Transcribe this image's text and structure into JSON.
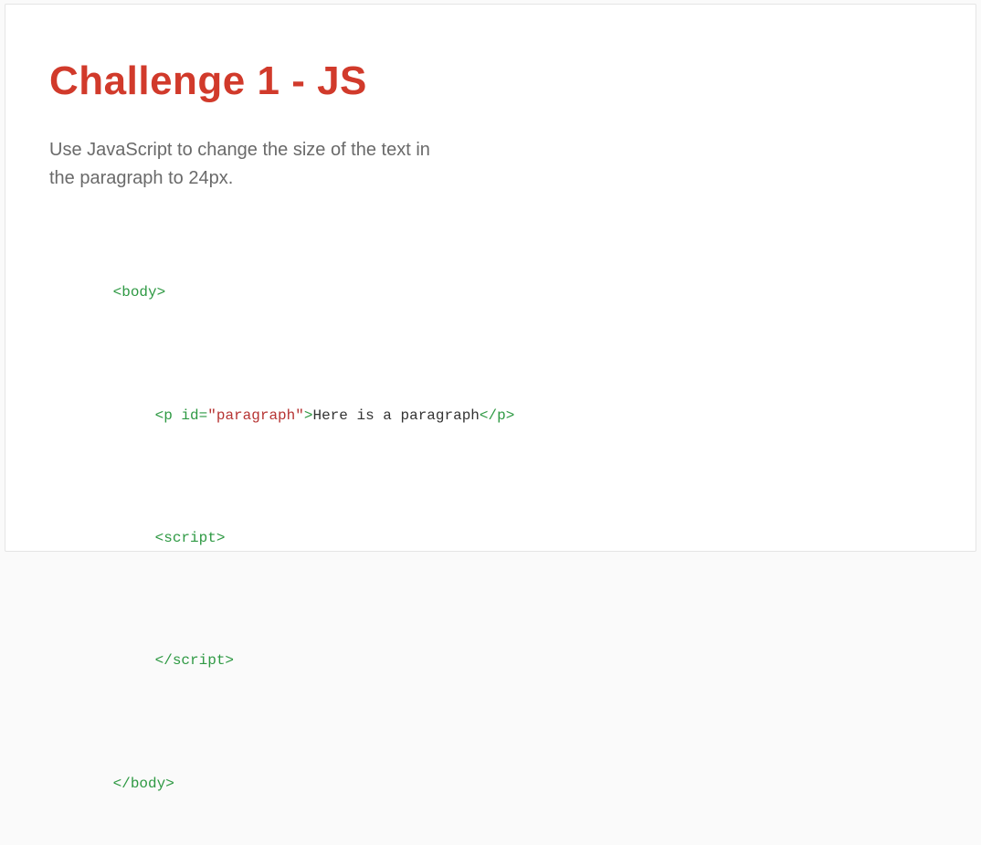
{
  "slide": {
    "title": "Challenge 1 - JS",
    "description": "Use JavaScript to change the size of the text in the paragraph to 24px."
  },
  "code": {
    "lines": [
      {
        "indent": 0,
        "tokens": [
          {
            "cls": "tag",
            "text": "<body>"
          }
        ]
      },
      {
        "indent": 1,
        "tokens": [
          {
            "cls": "tag",
            "text": "<p "
          },
          {
            "cls": "attr-name",
            "text": "id="
          },
          {
            "cls": "attr-value",
            "text": "\"paragraph\""
          },
          {
            "cls": "tag",
            "text": ">"
          },
          {
            "cls": "text-content",
            "text": "Here is a paragraph"
          },
          {
            "cls": "tag",
            "text": "</p>"
          }
        ]
      },
      {
        "indent": 1,
        "tokens": [
          {
            "cls": "tag",
            "text": "<script>"
          }
        ]
      },
      {
        "indent": 1,
        "tokens": [
          {
            "cls": "tag",
            "text": "</script>"
          }
        ]
      },
      {
        "indent": 0,
        "tokens": [
          {
            "cls": "tag",
            "text": "</body>"
          }
        ]
      }
    ]
  }
}
